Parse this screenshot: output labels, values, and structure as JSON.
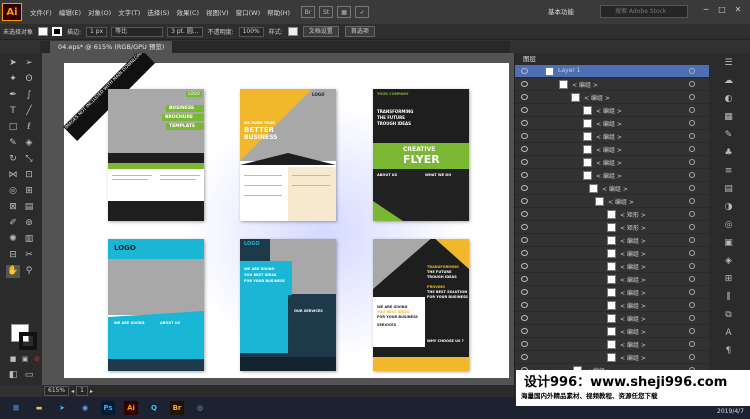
{
  "app": {
    "logo": "Ai"
  },
  "menubar": {
    "items": [
      "文件(F)",
      "编辑(E)",
      "对象(O)",
      "文字(T)",
      "选择(S)",
      "效果(C)",
      "视图(V)",
      "窗口(W)",
      "帮助(H)"
    ],
    "workspace": "基本功能",
    "search_placeholder": "搜索 Adobe Stock"
  },
  "controlbar": {
    "selection": "未选择对象",
    "stroke_weight": "1 px",
    "stroke_style": "等比",
    "brush": "3 pt. 圆...",
    "opacity_label": "不透明度:",
    "opacity": "100%",
    "style_label": "样式:",
    "doc_setup": "文档设置",
    "prefs": "首选项"
  },
  "document": {
    "tab": "04.eps* @ 615% (RGB/GPU 预览)"
  },
  "status": {
    "zoom": "615%",
    "page": "1"
  },
  "canvas": {
    "ribbon": "IMAGES NOT INCLUDED WITH MAIN DOWNLOAD"
  },
  "flyers": {
    "f1": {
      "logo": "LOGO",
      "title1": "BUSINESS",
      "title2": "BROCHURE",
      "title3": "TEMPLATE"
    },
    "f2": {
      "logo": "LOGO",
      "tag": "WE MAKE YOUR",
      "title1": "BETTER",
      "title2": "BUSINESS"
    },
    "f3": {
      "company": "YOUR COMPANY",
      "tag1": "TRANSFORMING",
      "tag2": "THE FUTURE",
      "tag3": "TROUGH IDEAS",
      "title1": "CREATIVE",
      "title2": "FLYER",
      "about": "ABOUT US",
      "what": "WHAT WE DO"
    },
    "f4": {
      "logo": "LOGO",
      "tag": "WE ARE GIVING",
      "about": "ABOUT US"
    },
    "f5": {
      "logo": "LOGO",
      "tag1": "WE ARE GIVING",
      "tag2": "YOU BEST IDEAS",
      "tag3": "FOR YOUR BUSINESS",
      "services": "OUR SERVICES"
    },
    "f6": {
      "logo": "LOGO",
      "tag1": "TRANSFORMING",
      "tag2": "THE FUTURE",
      "tag3": "TROUGH IDEAS",
      "prov1": "PROVING",
      "prov2": "THE BEST SOLUTION",
      "prov3": "FOR YOUR BUSINESS",
      "give1": "WE ARE GIVING",
      "give2": "YOU BEST IDEAS",
      "give3": "FOR YOUR BUSINESS",
      "services": "SERVICES",
      "choose": "WHY CHOOSE US ?"
    }
  },
  "layers": {
    "title": "图层",
    "rows": [
      "Layer 1",
      "< 编组 >",
      "< 编组 >",
      "< 编组 >",
      "< 编组 >",
      "< 编组 >",
      "< 编组 >",
      "< 编组 >",
      "< 编组 >",
      "< 编组 >",
      "< 编组 >",
      "< 矩形 >",
      "< 矩形 >",
      "< 编组 >",
      "< 编组 >",
      "< 编组 >",
      "< 编组 >",
      "< 编组 >",
      "< 编组 >",
      "< 编组 >",
      "< 编组 >",
      "< 编组 >",
      "< 编组 >",
      "< 编组 >"
    ]
  },
  "watermark": {
    "line1": "设计996：www.sheji996.com",
    "line2": "海量国内外精品素材、视频教程、资源任您下载"
  },
  "taskbar": {
    "clock": "2019/4/7"
  },
  "colors": {
    "accent_orange": "#ff9a00",
    "layer_highlight": "#4e6fb5",
    "flyer_green": "#7ab733",
    "flyer_yellow": "#f0b82a",
    "flyer_cyan": "#19b6d6"
  }
}
